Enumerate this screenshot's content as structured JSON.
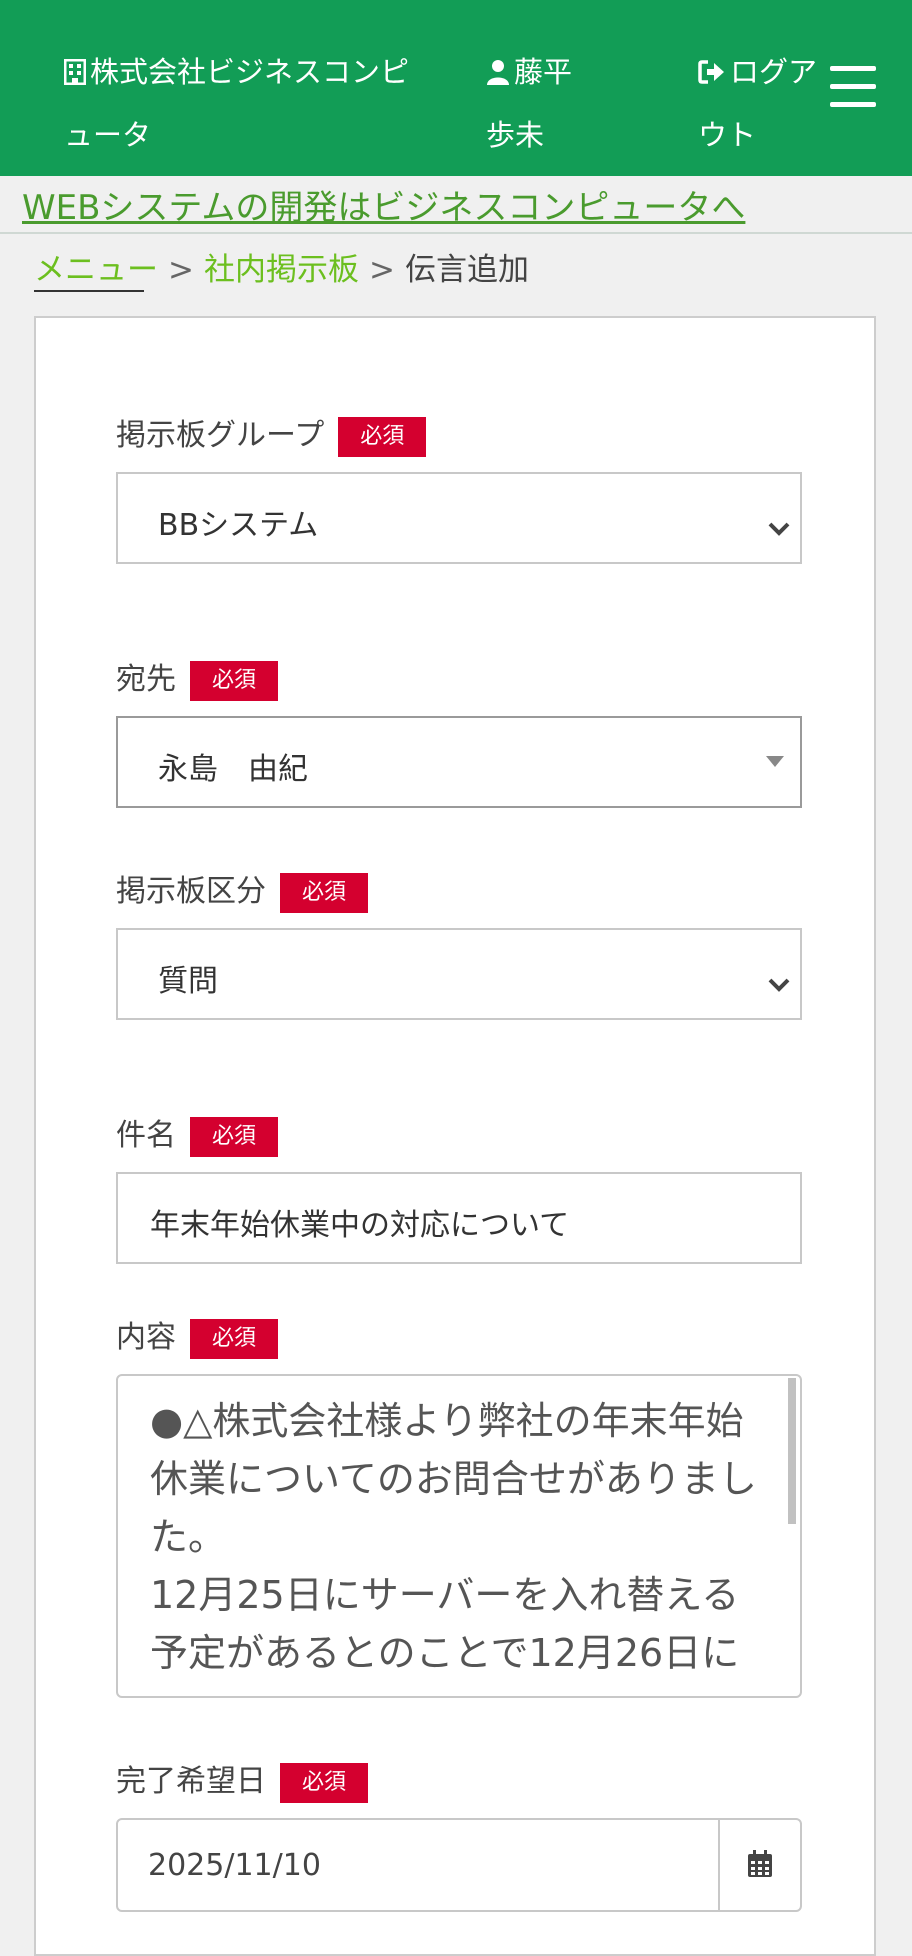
{
  "header": {
    "company": "株式会社ビジネスコンピュータ",
    "user": "藤平 歩未",
    "logout": "ログアウト"
  },
  "banner": {
    "link_text": "WEBシステムの開発はビジネスコンピュータへ"
  },
  "breadcrumb": {
    "items": [
      "メニュー",
      "社内掲示板"
    ],
    "separator": ">",
    "current": "伝言追加"
  },
  "form": {
    "required_label": "必須",
    "group": {
      "label": "掲示板グループ",
      "value": "BBシステム"
    },
    "recipient": {
      "label": "宛先",
      "value": "永島　由紀"
    },
    "category": {
      "label": "掲示板区分",
      "value": "質問"
    },
    "subject": {
      "label": "件名",
      "value": "年末年始休業中の対応について"
    },
    "content": {
      "label": "内容",
      "value": "●△株式会社様より弊社の年末年始休業についてのお問合せがありました。\n12月25日にサーバーを入れ替える予定があるとのことで12月26日に"
    },
    "due_date": {
      "label": "完了希望日",
      "value": "2025/11/10"
    }
  },
  "colors": {
    "header_bg": "#129d56",
    "required_bg": "#d4002f",
    "link": "#6cbf1f"
  }
}
